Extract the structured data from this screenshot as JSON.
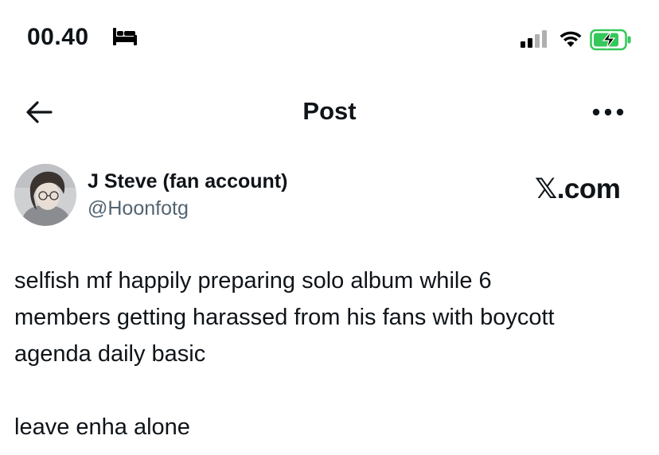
{
  "status_bar": {
    "time": "00.40",
    "icons": [
      "bed-icon",
      "cellular-signal-icon",
      "wifi-icon",
      "battery-charging-icon"
    ],
    "battery_color": "#34c759"
  },
  "nav": {
    "title": "Post",
    "back_icon": "arrow-left-icon",
    "more_icon": "more-horizontal-icon"
  },
  "post": {
    "author": {
      "display_name": "J Steve (fan account)",
      "handle": "@Hoonfotg"
    },
    "watermark": "𝕏.com",
    "lines": [
      "selfish mf happily preparing solo album while 6",
      "members getting harassed from his fans with boycott",
      "agenda daily basic"
    ],
    "last_line": "leave enha alone"
  },
  "colors": {
    "text": "#0f1419",
    "secondary_text": "#536471",
    "background": "#ffffff"
  }
}
